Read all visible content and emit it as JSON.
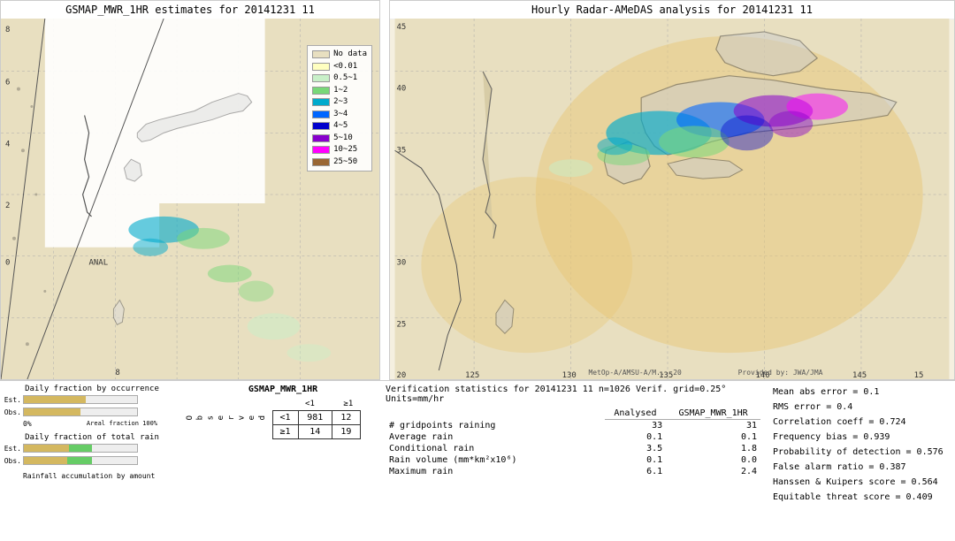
{
  "left_map": {
    "title": "GSMAP_MWR_1HR estimates for 20141231 11"
  },
  "right_map": {
    "title": "Hourly Radar-AMeDAS analysis for 20141231 11",
    "bottom_left": "MetOp-A/AMSU-A/M... 20",
    "bottom_right": "Provided by: JWA/JMA"
  },
  "legend": {
    "items": [
      {
        "label": "No data",
        "color": "#e8dfc0"
      },
      {
        "label": "<0.01",
        "color": "#ffffc0"
      },
      {
        "label": "0.5~1",
        "color": "#c8f0c8"
      },
      {
        "label": "1~2",
        "color": "#78d878"
      },
      {
        "label": "2~3",
        "color": "#00aacc"
      },
      {
        "label": "3~4",
        "color": "#0066ff"
      },
      {
        "label": "4~5",
        "color": "#0000cc"
      },
      {
        "label": "5~10",
        "color": "#8800cc"
      },
      {
        "label": "10~25",
        "color": "#ff00ff"
      },
      {
        "label": "25~50",
        "color": "#996633"
      }
    ]
  },
  "bottom": {
    "charts": {
      "title1": "Daily fraction by occurrence",
      "title2": "Daily fraction of total rain",
      "title3": "Rainfall accumulation by amount",
      "est_label": "Est.",
      "obs_label": "Obs.",
      "axis_0": "0%",
      "axis_100": "Areal fraction   100%"
    },
    "contingency": {
      "title": "GSMAP_MWR_1HR",
      "col_lt1": "<1",
      "col_ge1": "≥1",
      "obs_label": "O\nb\ns\ne\nr\nv\ne\nd",
      "row_lt1": "<1",
      "row_ge1": "≥1",
      "val_a": "981",
      "val_b": "12",
      "val_c": "14",
      "val_d": "19"
    },
    "verification": {
      "title": "Verification statistics for 20141231 11  n=1026  Verif. grid=0.25°  Units=mm/hr",
      "col_analysed": "Analysed",
      "col_gsmap": "GSMAP_MWR_1HR",
      "rows": [
        {
          "label": "# gridpoints raining",
          "val_a": "33",
          "val_b": "31"
        },
        {
          "label": "Average rain",
          "val_a": "0.1",
          "val_b": "0.1"
        },
        {
          "label": "Conditional rain",
          "val_a": "3.5",
          "val_b": "1.8"
        },
        {
          "label": "Rain volume (mm*km²x10⁶)",
          "val_a": "0.1",
          "val_b": "0.0"
        },
        {
          "label": "Maximum rain",
          "val_a": "6.1",
          "val_b": "2.4"
        }
      ]
    },
    "stats": {
      "mean_abs_error": "Mean abs error = 0.1",
      "rms_error": "RMS error = 0.4",
      "correlation": "Correlation coeff = 0.724",
      "freq_bias": "Frequency bias = 0.939",
      "pod": "Probability of detection = 0.576",
      "far": "False alarm ratio = 0.387",
      "hk": "Hanssen & Kuipers score = 0.564",
      "ets": "Equitable threat score = 0.409"
    }
  }
}
